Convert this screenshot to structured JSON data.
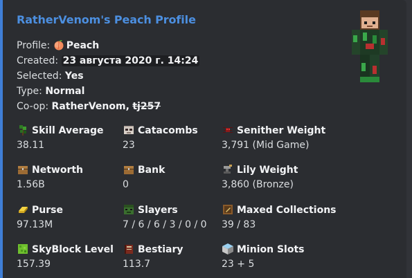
{
  "embed": {
    "title": "RatherVenom's Peach Profile",
    "profile": {
      "label": "Profile:",
      "value": "Peach",
      "emoji": "peach-emoji"
    },
    "created": {
      "label": "Created:",
      "value": "23 августа 2020 г. 14:24"
    },
    "selected": {
      "label": "Selected:",
      "value": "Yes"
    },
    "type": {
      "label": "Type:",
      "value": "Normal"
    },
    "coop": {
      "label": "Co-op:",
      "member1": "RatherVenom,",
      "member2": "tj257"
    },
    "accent_color": "#3f7ed6",
    "title_color": "#4c8fe0"
  },
  "fields": [
    {
      "name": "Skill Average",
      "value": "38.11",
      "icon": "sapling-icon"
    },
    {
      "name": "Catacombs",
      "value": "23",
      "icon": "skull-icon"
    },
    {
      "name": "Senither Weight",
      "value": "3,791 (Mid Game)",
      "icon": "spider-icon"
    },
    {
      "name": "Networth",
      "value": "1.56B",
      "icon": "chest-icon"
    },
    {
      "name": "Bank",
      "value": "0",
      "icon": "bank-chest-icon"
    },
    {
      "name": "Lily Weight",
      "value": "3,860 (Bronze)",
      "icon": "anvil-icon"
    },
    {
      "name": "Purse",
      "value": "97.13M",
      "icon": "gold-ingot-icon"
    },
    {
      "name": "Slayers",
      "value": "7 / 6 / 6 / 3 / 0 / 0",
      "icon": "zombie-head-icon"
    },
    {
      "name": "Maxed Collections",
      "value": "39 / 83",
      "icon": "item-frame-icon"
    },
    {
      "name": "SkyBlock Level",
      "value": "157.39",
      "icon": "grass-block-icon"
    },
    {
      "name": "Bestiary",
      "value": "113.7",
      "icon": "book-icon"
    },
    {
      "name": "Minion Slots",
      "value": "23 + 5",
      "icon": "cobblestone-icon"
    }
  ],
  "thumbnail": {
    "icon": "player-skin-render"
  }
}
